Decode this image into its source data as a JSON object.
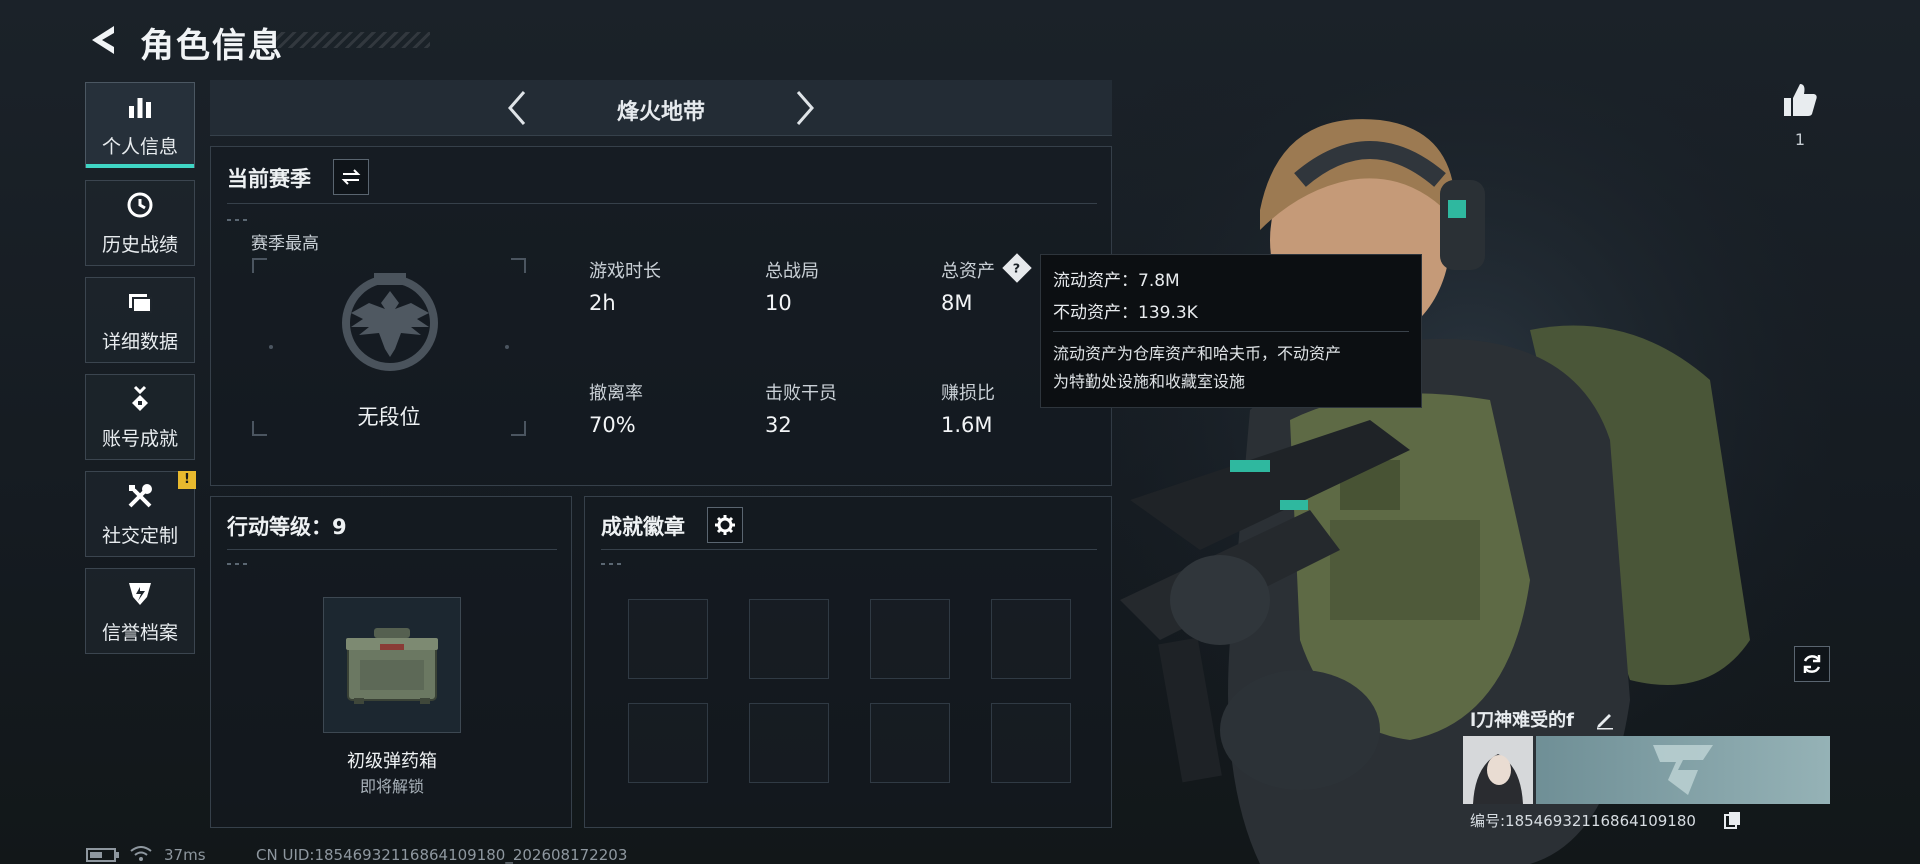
{
  "header": {
    "title": "角色信息"
  },
  "sidebar": {
    "items": [
      {
        "label": "个人信息",
        "icon": "bar-chart-icon"
      },
      {
        "label": "历史战绩",
        "icon": "history-icon"
      },
      {
        "label": "详细数据",
        "icon": "folder-icon"
      },
      {
        "label": "账号成就",
        "icon": "medal-icon"
      },
      {
        "label": "社交定制",
        "icon": "tools-icon",
        "badge": "!"
      },
      {
        "label": "信誉档案",
        "icon": "shield-icon"
      }
    ]
  },
  "mode": {
    "title": "烽火地带"
  },
  "season": {
    "title": "当前赛季",
    "best_label": "赛季最高",
    "rank": "无段位",
    "stats": [
      {
        "label": "游戏时长",
        "value": "2h"
      },
      {
        "label": "总战局",
        "value": "10"
      },
      {
        "label": "总资产",
        "value": "8M"
      },
      {
        "label": "撤离率",
        "value": "70%"
      },
      {
        "label": "击败干员",
        "value": "32"
      },
      {
        "label": "赚损比",
        "value": "1.6M"
      }
    ]
  },
  "tooltip": {
    "liquid": "流动资产：7.8M",
    "fixed": "不动资产：139.3K",
    "desc_line1": "流动资产为仓库资产和哈夫币，不动资产",
    "desc_line2": "为特勤处设施和收藏室设施"
  },
  "action_level": {
    "title": "行动等级：9",
    "reward_name": "初级弹药箱",
    "reward_status": "即将解锁"
  },
  "badges": {
    "title": "成就徽章"
  },
  "profile": {
    "likes": "1",
    "name": "l刀神难受的f",
    "id_text": "编号:18546932116864109180"
  },
  "status_bar": {
    "ping": "37ms",
    "uid": "CN UID:18546932116864109180_202608172203"
  },
  "colors": {
    "accent": "#3fd6c5",
    "warning": "#e8b92e",
    "tooltip_bg": "#0c0f12"
  }
}
